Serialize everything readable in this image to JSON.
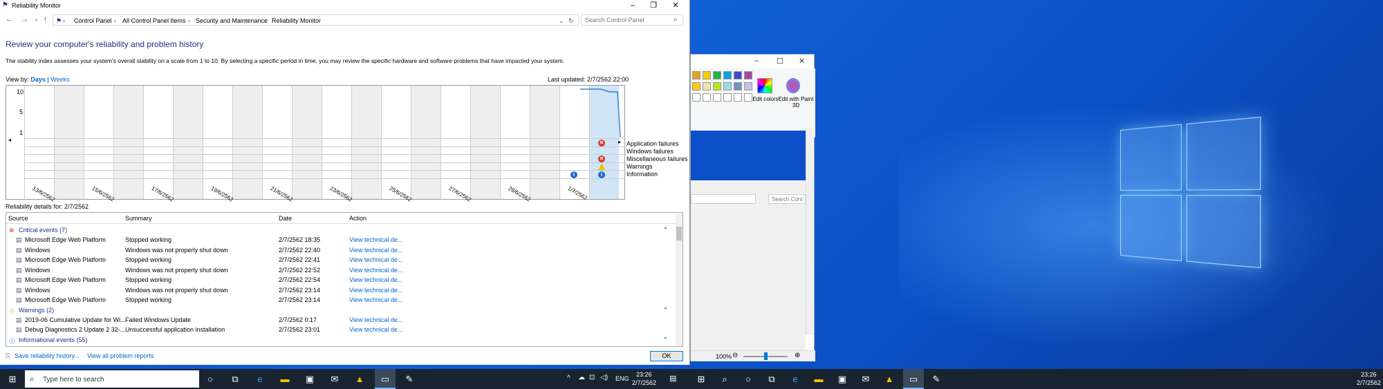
{
  "window": {
    "title": "Reliability Monitor",
    "breadcrumb": [
      "Control Panel",
      "All Control Panel Items",
      "Security and Maintenance",
      "Reliability Monitor"
    ],
    "search_placeholder": "Search Control Panel"
  },
  "page": {
    "heading": "Review your computer's reliability and problem history",
    "description": "The stability index assesses your system's overall stability on a scale from 1 to 10. By selecting a specific period in time, you may review the specific hardware and software problems that have impacted your system.",
    "view_by_label": "View by:",
    "view_days": "Days",
    "view_sep": "|",
    "view_weeks": "Weeks",
    "last_updated": "Last updated: 2/7/2562 22:00"
  },
  "chart_data": {
    "type": "line",
    "title": "",
    "y_ticks": [
      "10",
      "5",
      "1"
    ],
    "ylim": [
      1,
      10
    ],
    "x_labels": [
      "13/6/2562",
      "15/6/2562",
      "17/6/2562",
      "19/6/2562",
      "21/6/2562",
      "23/6/2562",
      "25/6/2562",
      "27/6/2562",
      "29/6/2562",
      "1/7/2562"
    ],
    "row_labels": [
      "Application failures",
      "Windows failures",
      "Miscellaneous failures",
      "Warnings",
      "Information"
    ],
    "series": [
      {
        "values": [
          10,
          10,
          9.5,
          9.5,
          1
        ]
      }
    ],
    "selected_day": "2/7/2562"
  },
  "details": {
    "label": "Reliability details for: 2/7/2562",
    "columns": [
      "Source",
      "Summary",
      "Date",
      "Action"
    ],
    "critical_header": "Critical events (7)",
    "critical": [
      {
        "source": "Microsoft Edge Web Platform",
        "summary": "Stopped working",
        "date": "2/7/2562 18:35",
        "action": "View technical de..."
      },
      {
        "source": "Windows",
        "summary": "Windows was not properly shut down",
        "date": "2/7/2562 22:40",
        "action": "View technical de..."
      },
      {
        "source": "Microsoft Edge Web Platform",
        "summary": "Stopped working",
        "date": "2/7/2562 22:41",
        "action": "View technical de..."
      },
      {
        "source": "Windows",
        "summary": "Windows was not properly shut down",
        "date": "2/7/2562 22:52",
        "action": "View technical de..."
      },
      {
        "source": "Microsoft Edge Web Platform",
        "summary": "Stopped working",
        "date": "2/7/2562 22:54",
        "action": "View technical de..."
      },
      {
        "source": "Windows",
        "summary": "Windows was not properly shut down",
        "date": "2/7/2562 23:14",
        "action": "View technical de..."
      },
      {
        "source": "Microsoft Edge Web Platform",
        "summary": "Stopped working",
        "date": "2/7/2562 23:14",
        "action": "View technical de..."
      }
    ],
    "warnings_header": "Warnings (2)",
    "warnings": [
      {
        "source": "2019-06 Cumulative Update for Wi...",
        "summary": "Failed Windows Update",
        "date": "2/7/2562 0:17",
        "action": "View technical de..."
      },
      {
        "source": "Debug Diagnostics 2 Update 2 32-...",
        "summary": "Unsuccessful application installation",
        "date": "2/7/2562 23:01",
        "action": "View technical de..."
      }
    ],
    "info_header": "Informational events (55)"
  },
  "footer": {
    "save_link": "Save reliability history...",
    "view_all_link": "View all problem reports",
    "ok": "OK"
  },
  "paint": {
    "edit_colors": "Edit colors",
    "edit_paint3d": "Edit with Paint 3D",
    "search": "Search Cont",
    "zoom": "100%",
    "palette": [
      "#e8a020",
      "#f2d000",
      "#22b14c",
      "#00a2e8",
      "#3f48cc",
      "#a349a4",
      "#ffc90e",
      "#efe4b0",
      "#b5e61d",
      "#99d9ea",
      "#7092be",
      "#c8bfe7"
    ]
  },
  "taskbar": {
    "search_placeholder": "Type here to search",
    "lang": "ENG",
    "time": "23:26",
    "date": "2/7/2562",
    "time2": "23:26",
    "date2": "2/7/2562"
  }
}
